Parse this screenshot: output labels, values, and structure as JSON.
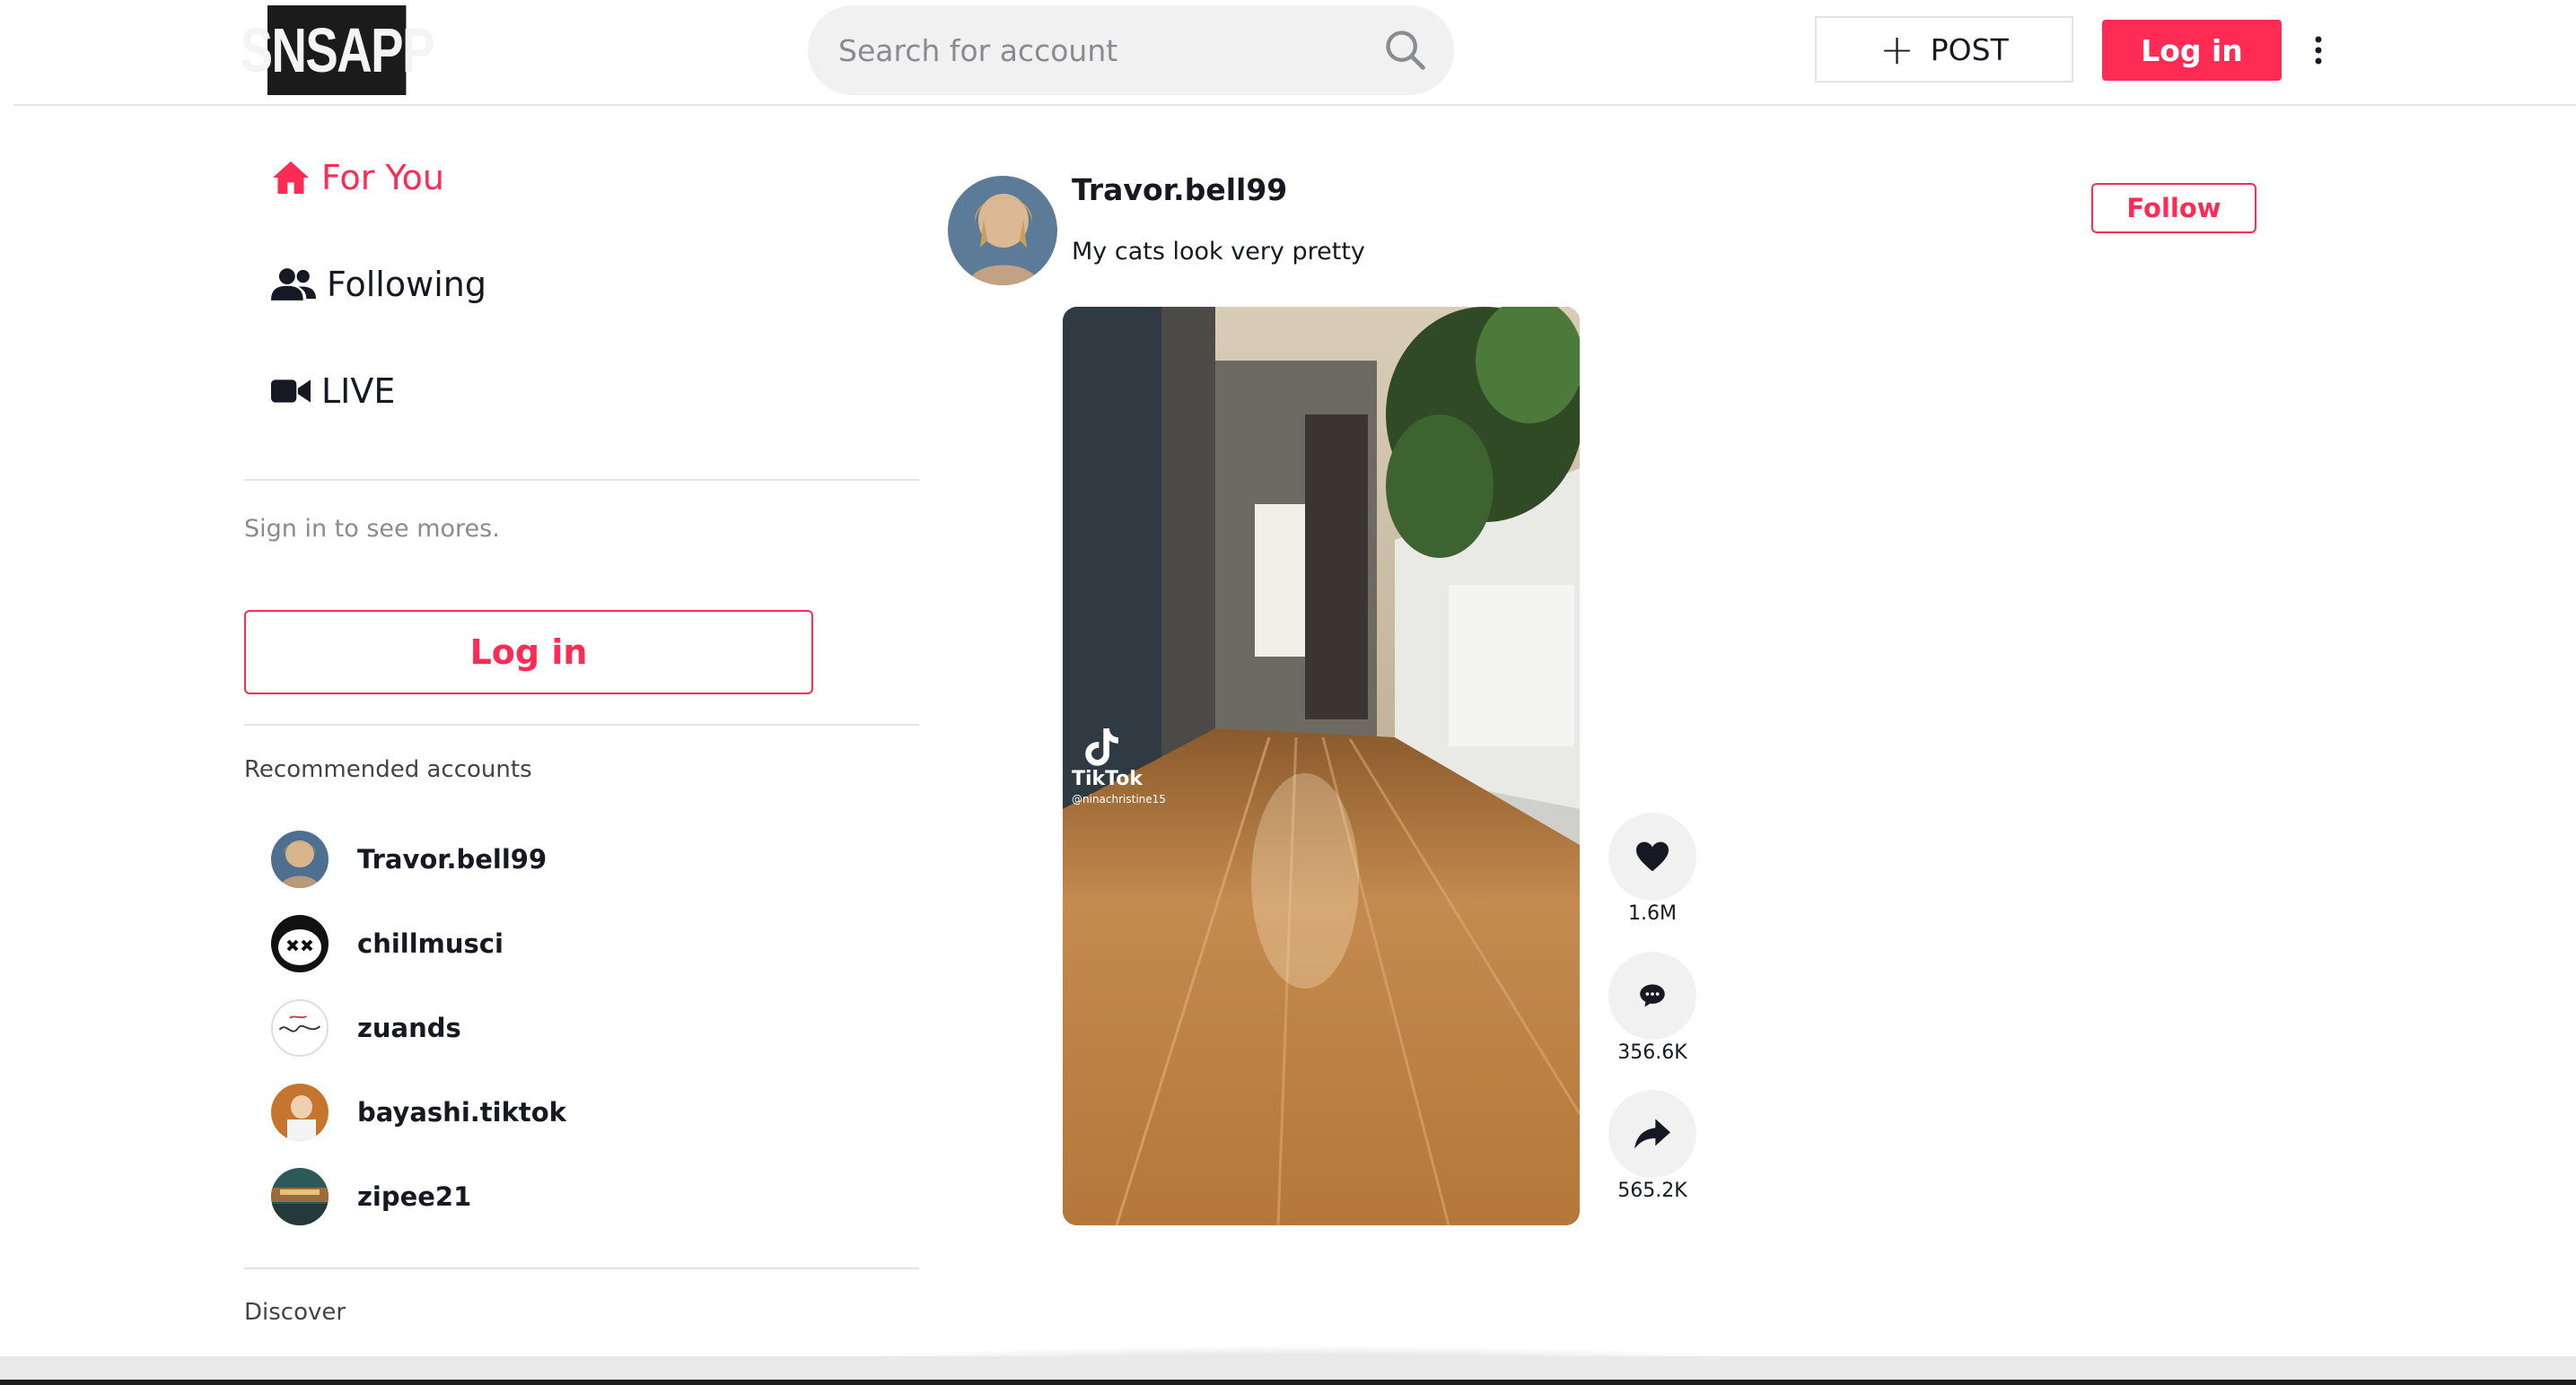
{
  "header": {
    "logo_text": "SNSAPP",
    "search_placeholder": "Search for account",
    "post_label": "POST",
    "login_label": "Log in"
  },
  "sidebar": {
    "nav": [
      {
        "label": "For You",
        "icon": "home-icon",
        "active": true
      },
      {
        "label": "Following",
        "icon": "users-icon",
        "active": false
      },
      {
        "label": "LIVE",
        "icon": "video-camera-icon",
        "active": false
      }
    ],
    "signin_prompt": "Sign in to see mores.",
    "login_label": "Log in",
    "recommended_title": "Recommended accounts",
    "accounts": [
      {
        "name": "Travor.bell99"
      },
      {
        "name": "chillmusci"
      },
      {
        "name": "zuands"
      },
      {
        "name": "bayashi.tiktok"
      },
      {
        "name": "zipee21"
      }
    ],
    "discover_title": "Discover"
  },
  "post": {
    "username": "Travor.bell99",
    "caption": "My cats look very pretty",
    "follow_label": "Follow",
    "watermark_brand": "TikTok",
    "watermark_handle": "@ninachristine15",
    "actions": [
      {
        "icon": "heart-icon",
        "count": "1.6M"
      },
      {
        "icon": "comment-icon",
        "count": "356.6K"
      },
      {
        "icon": "share-icon",
        "count": "565.2K"
      }
    ]
  },
  "colors": {
    "accent": "#fe2c55",
    "text": "#161823",
    "muted": "#8a8b91"
  }
}
